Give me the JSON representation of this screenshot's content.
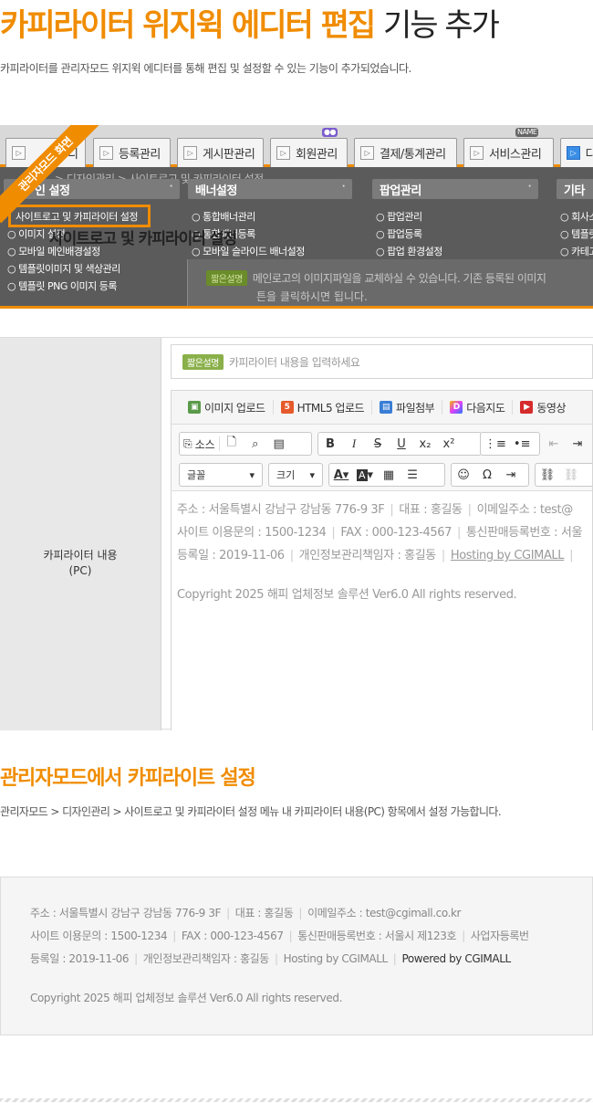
{
  "hero": {
    "title_highlight": "카피라이터 위지윅 에디터 편집",
    "title_rest": "기능 추가",
    "description": "카피라이터를 관리자모드 위지윅 에디터를 통해 편집 및 설정할 수 있는 기능이 추가되었습니다."
  },
  "admin": {
    "ribbon": "관리자모드 화면",
    "tabs": [
      {
        "label": "디"
      },
      {
        "label": "등록관리"
      },
      {
        "label": "게시판관리"
      },
      {
        "label": "회원관리"
      },
      {
        "label": "결제/통계관리"
      },
      {
        "label": "서비스관리"
      },
      {
        "label": "디"
      }
    ],
    "tab_badge_name": "NAME",
    "breadcrumb_ghost": "> 디자인관리 > 사이트로고 및 카피라이터 설정",
    "menus": [
      {
        "title": "인 설정",
        "items": [
          "사이트로고 및 카피라이터 설정",
          "이미지 설정",
          "모바일 메인배경설정",
          "템플릿이미지 및 색상관리",
          "템플릿 PNG 이미지 등록"
        ]
      },
      {
        "title": "배너설정",
        "items": [
          "통합배너관리",
          "통합배너등록",
          "모바일 슬라이드 배너설정"
        ]
      },
      {
        "title": "팝업관리",
        "items": [
          "팝업관리",
          "팝업등록",
          "팝업 환경설정"
        ]
      },
      {
        "title": "기타",
        "items": [
          "회사소",
          "템플릿",
          "카테고"
        ]
      }
    ],
    "ghost_title": "사이트로고 및 카피라이터 설정",
    "short_badge": "짧은설명",
    "content_text": "메인로고의 이미지파일을 교체하실 수 있습니다. 기존 등록된 이미지",
    "content_text2": "튼을 클릭하시면 됩니다."
  },
  "editor_section": {
    "label": "카피라이터 내용",
    "label_sub": "(PC)",
    "short_badge": "짧은설명",
    "short_placeholder": "카피라이터 내용을 입력하세요",
    "upload_buttons": [
      "이미지 업로드",
      "HTML5 업로드",
      "파일첨부",
      "다음지도",
      "동영상"
    ],
    "toolbar": {
      "source": "소스",
      "font": "글꼴",
      "size": "크기"
    },
    "body": {
      "line1": [
        "주소 : 서울특별시 강남구 강남동 776-9 3F",
        "대표 : 홍길동",
        "이메일주소 : test@"
      ],
      "line2": [
        "사이트 이용문의 : 1500-1234",
        "FAX : 000-123-4567",
        "통신판매등록번호 : 서울"
      ],
      "line3": [
        "등록일 : 2019-11-06",
        "개인정보관리책임자 : 홍길동",
        "Hosting by CGIMALL"
      ],
      "copyright": "Copyright 2025 해피 업체정보 솔루션 Ver6.0 All rights reserved."
    }
  },
  "section2": {
    "title": "관리자모드에서 카피라이트 설정",
    "description": "관리자모드 > 디자인관리 > 사이트로고 및 카피라이터 설정 메뉴 내 카피라이터 내용(PC) 항목에서 설정 가능합니다."
  },
  "footer_preview": {
    "line1": [
      "주소 : 서울특별시 강남구 강남동 776-9 3F",
      "대표 : 홍길동",
      "이메일주소 : test@cgimall.co.kr"
    ],
    "line2": [
      "사이트 이용문의 : 1500-1234",
      "FAX : 000-123-4567",
      "통신판매등록번호 : 서울시 제123호",
      "사업자등록번"
    ],
    "line3": [
      "등록일 : 2019-11-06",
      "개인정보관리책임자 : 홍길동",
      "Hosting by CGIMALL"
    ],
    "powered": "Powered by CGIMALL",
    "copyright": "Copyright 2025 해피 업체정보 솔루션 Ver6.0 All rights reserved."
  }
}
